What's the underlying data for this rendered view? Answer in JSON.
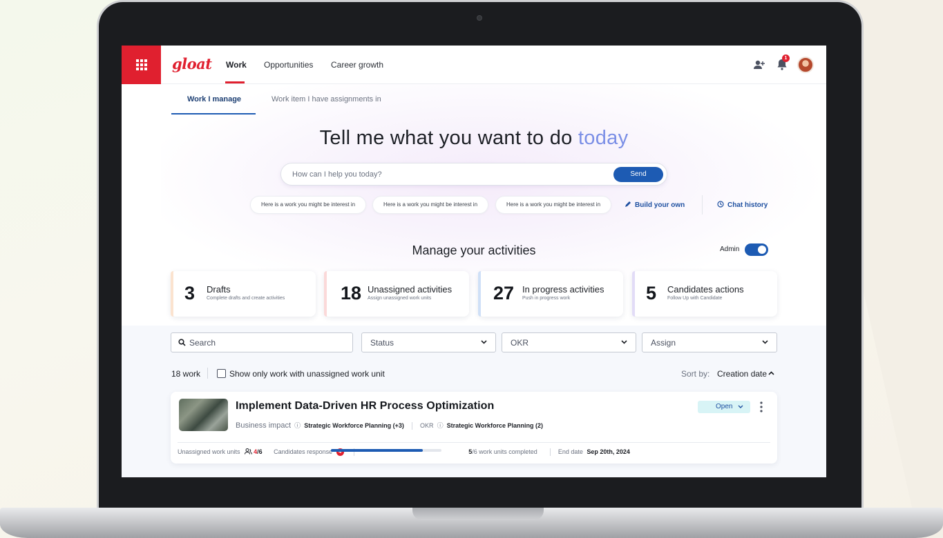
{
  "nav": {
    "logo": "gloat",
    "items": [
      {
        "label": "Work",
        "active": true
      },
      {
        "label": "Opportunities",
        "active": false
      },
      {
        "label": "Career growth",
        "active": false
      }
    ],
    "notification_count": "1",
    "accent_color": "#e0202f"
  },
  "subtabs": [
    {
      "label": "Work I manage",
      "active": true
    },
    {
      "label": "Work item I have assignments in",
      "active": false
    }
  ],
  "hero": {
    "title_main": "Tell me what you want to do ",
    "title_accent": "today",
    "placeholder": "How can I help you today?",
    "send_label": "Send",
    "suggestions": [
      "Here is a work you might be interest in",
      "Here is a work you might be interest in",
      "Here is a work you might be interest in"
    ],
    "build_label": "Build your own",
    "history_label": "Chat history"
  },
  "activities": {
    "title": "Manage your activities",
    "admin_label": "Admin",
    "admin_on": true,
    "cards": [
      {
        "count": "3",
        "title": "Drafts",
        "desc": "Complete drafts and create activities",
        "accent": "#fbe3cf"
      },
      {
        "count": "18",
        "title": "Unassigned activities",
        "desc": "Assign unassigned work units",
        "accent": "#fbd9d9"
      },
      {
        "count": "27",
        "title": "In progress activities",
        "desc": "Push in progress work",
        "accent": "#cfe0f7"
      },
      {
        "count": "5",
        "title": "Candidates actions",
        "desc": "Follow Up with Candidate",
        "accent": "#e2dcf7"
      }
    ]
  },
  "filters": {
    "search": "Search",
    "status": "Status",
    "okr": "OKR",
    "assign": "Assign"
  },
  "list": {
    "count": "18 work",
    "checkbox_label": "Show only work with unassigned work unit",
    "sort_label": "Sort by:",
    "sort_value": "Creation date"
  },
  "work_item": {
    "title": "Implement Data-Driven HR Process Optimization",
    "business_impact_label": "Business impact",
    "business_impact_value": "Strategic Workforce Planning (+3)",
    "okr_label": "OKR",
    "okr_value": "Strategic Workforce Planning (2)",
    "status": "Open",
    "unassigned_label": "Unassigned work units",
    "unassigned_value": "4",
    "unassigned_total": "/6",
    "candidates_label": "Candidates response",
    "candidates_count": "4",
    "progress_fraction": 0.83,
    "completed_value": "5",
    "completed_text": "/6 work units completed",
    "end_date_label": "End date",
    "end_date_value": "Sep 20th, 2024"
  }
}
